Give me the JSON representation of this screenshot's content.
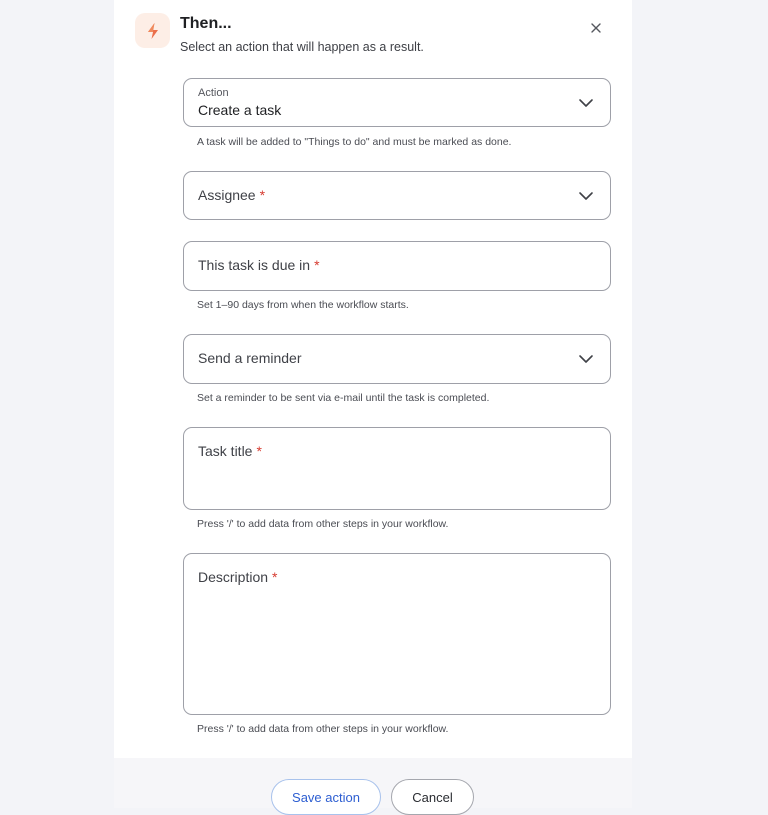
{
  "header": {
    "title": "Then...",
    "subtitle": "Select an action that will happen as a result.",
    "icon": "lightning-bolt-icon",
    "accent_color": "#e8572f"
  },
  "action": {
    "label": "Action",
    "value": "Create a task",
    "hint": "A task will be added to \"Things to do\" and must be marked as done."
  },
  "assignee": {
    "label": "Assignee",
    "required": "*"
  },
  "due": {
    "label": "This task is due in",
    "required": "*",
    "hint": "Set 1–90 days from when the workflow starts."
  },
  "reminder": {
    "label": "Send a reminder",
    "hint": "Set a reminder to be sent via e-mail until the task is completed."
  },
  "task_title": {
    "label": "Task title",
    "required": "*",
    "hint": "Press '/' to add data from other steps in your workflow."
  },
  "description": {
    "label": "Description",
    "required": "*",
    "hint": "Press '/' to add data from other steps in your workflow."
  },
  "footer": {
    "save_label": "Save action",
    "cancel_label": "Cancel"
  }
}
